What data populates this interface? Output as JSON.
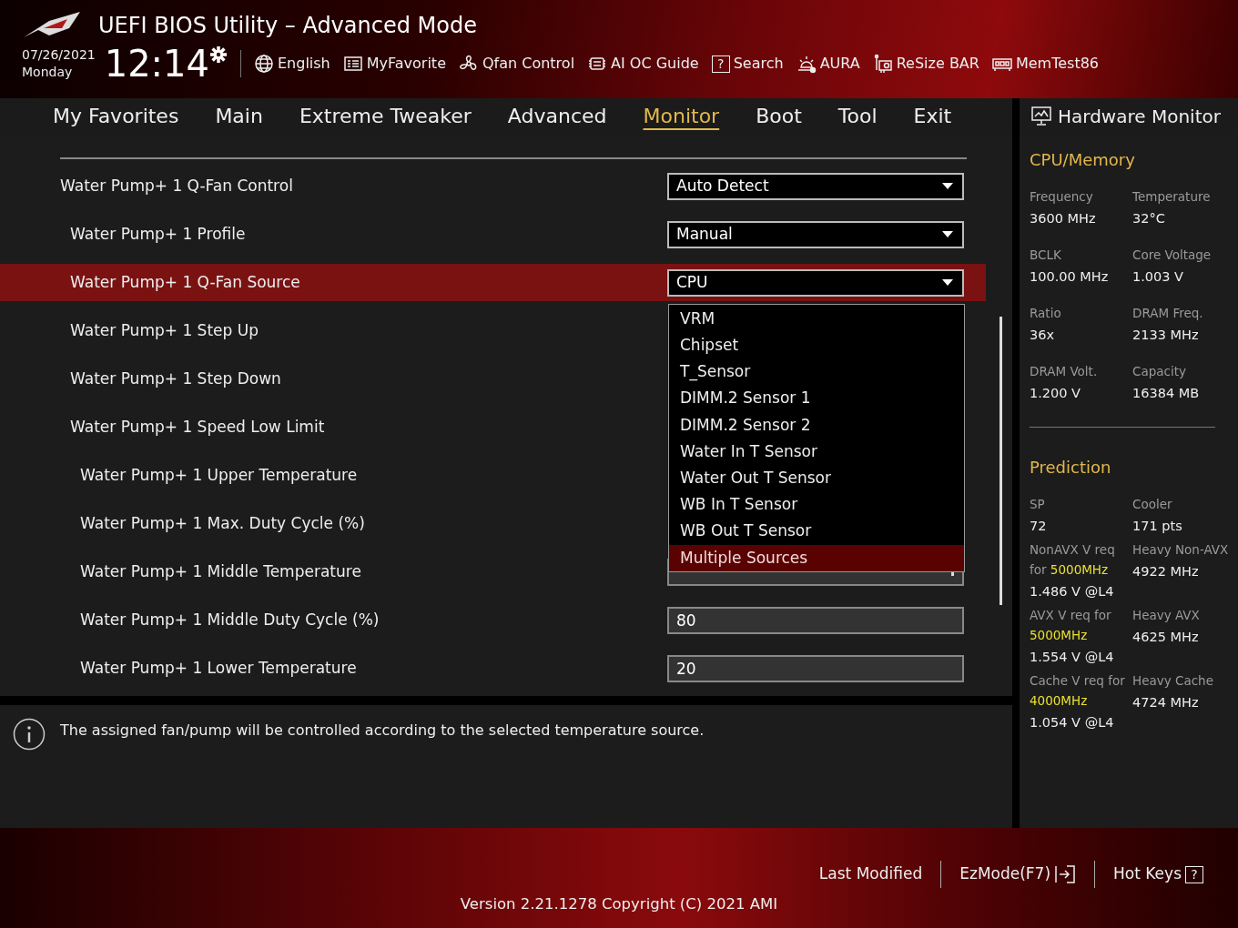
{
  "header": {
    "title": "UEFI BIOS Utility – Advanced Mode",
    "date": "07/26/2021",
    "day": "Monday",
    "time": "12:14",
    "tools": [
      {
        "kind": "globe",
        "label": "English"
      },
      {
        "kind": "favorite",
        "label": "MyFavorite"
      },
      {
        "kind": "fan",
        "label": "Qfan Control"
      },
      {
        "kind": "chip",
        "label": "AI OC Guide"
      },
      {
        "kind": "search",
        "glyph": "?",
        "label": "Search"
      },
      {
        "kind": "light",
        "label": "AURA"
      },
      {
        "kind": "card",
        "label": "ReSize BAR"
      },
      {
        "kind": "memory",
        "label": "MemTest86"
      }
    ]
  },
  "tabs": [
    {
      "label": "My Favorites",
      "selected": false
    },
    {
      "label": "Main",
      "selected": false
    },
    {
      "label": "Extreme Tweaker",
      "selected": false
    },
    {
      "label": "Advanced",
      "selected": false
    },
    {
      "label": "Monitor",
      "selected": true
    },
    {
      "label": "Boot",
      "selected": false
    },
    {
      "label": "Tool",
      "selected": false
    },
    {
      "label": "Exit",
      "selected": false
    }
  ],
  "settings": [
    {
      "label": "Water Pump+ 1 Q-Fan Control",
      "kind": "dropdown",
      "value": "Auto Detect",
      "selected": false,
      "children": [
        {
          "label": "Water Pump+ 1 Profile",
          "kind": "dropdown",
          "value": "Manual",
          "selected": false
        },
        {
          "label": "Water Pump+ 1 Q-Fan Source",
          "kind": "dropdown",
          "value": "CPU",
          "selected": true,
          "options": [
            {
              "label": "VRM",
              "selected": false
            },
            {
              "label": "Chipset",
              "selected": false
            },
            {
              "label": "T_Sensor",
              "selected": false
            },
            {
              "label": "DIMM.2 Sensor 1",
              "selected": false
            },
            {
              "label": "DIMM.2 Sensor 2",
              "selected": false
            },
            {
              "label": "Water In T Sensor",
              "selected": false
            },
            {
              "label": "Water Out T Sensor",
              "selected": false
            },
            {
              "label": "WB In T Sensor",
              "selected": false
            },
            {
              "label": "WB Out T Sensor",
              "selected": false
            },
            {
              "label": "Multiple Sources",
              "selected": true
            }
          ]
        },
        {
          "label": "Water Pump+ 1 Step Up",
          "selected": false
        },
        {
          "label": "Water Pump+ 1 Step Down",
          "selected": false
        },
        {
          "label": "Water Pump+ 1 Speed Low Limit",
          "selected": false,
          "children": [
            {
              "label": "Water Pump+ 1 Upper Temperature",
              "selected": false
            },
            {
              "label": "Water Pump+ 1 Max. Duty Cycle (%)",
              "selected": false
            },
            {
              "label": "Water Pump+ 1 Middle Temperature",
              "kind": "number",
              "selected": false
            },
            {
              "label": "Water Pump+ 1 Middle Duty Cycle (%)",
              "kind": "number",
              "value": "80",
              "selected": false
            },
            {
              "label": "Water Pump+ 1 Lower Temperature",
              "kind": "number",
              "value": "20",
              "selected": false
            }
          ]
        }
      ]
    }
  ],
  "help_text": "The assigned fan/pump will be controlled according to the selected temperature source.",
  "hardware_monitor": {
    "title": "Hardware Monitor",
    "sections": [
      {
        "title": "CPU/Memory",
        "items": [
          {
            "label": "Frequency",
            "value": "3600 MHz"
          },
          {
            "label": "Temperature",
            "value": "32°C"
          },
          {
            "label": "BCLK",
            "value": "100.00 MHz"
          },
          {
            "label": "Core Voltage",
            "value": "1.003 V"
          },
          {
            "label": "Ratio",
            "value": "36x"
          },
          {
            "label": "DRAM Freq.",
            "value": "2133 MHz"
          },
          {
            "label": "DRAM Volt.",
            "value": "1.200 V"
          },
          {
            "label": "Capacity",
            "value": "16384 MB"
          }
        ]
      },
      {
        "title": "Prediction",
        "items": [
          {
            "label": "SP",
            "value": "72"
          },
          {
            "label": "Cooler",
            "value": "171 pts"
          },
          {
            "label": "NonAVX V req for",
            "highlight": "5000MHz",
            "value": "1.486 V @L4"
          },
          {
            "label": "Heavy Non-AVX",
            "value": "4922 MHz"
          },
          {
            "label": "AVX V req for",
            "highlight": "5000MHz",
            "value": "1.554 V @L4"
          },
          {
            "label": "Heavy AVX",
            "value": "4625 MHz"
          },
          {
            "label": "Cache V req for",
            "highlight": "4000MHz",
            "value": "1.054 V @L4"
          },
          {
            "label": "Heavy Cache",
            "value": "4724 MHz"
          }
        ]
      }
    ]
  },
  "footer": {
    "buttons": [
      {
        "label": "Last Modified"
      },
      {
        "label": "EzMode(F7)",
        "kind": "exit"
      },
      {
        "label": "Hot Keys",
        "kind": "help",
        "glyph": "?"
      }
    ],
    "version": "Version 2.21.1278 Copyright (C) 2021 AMI"
  }
}
